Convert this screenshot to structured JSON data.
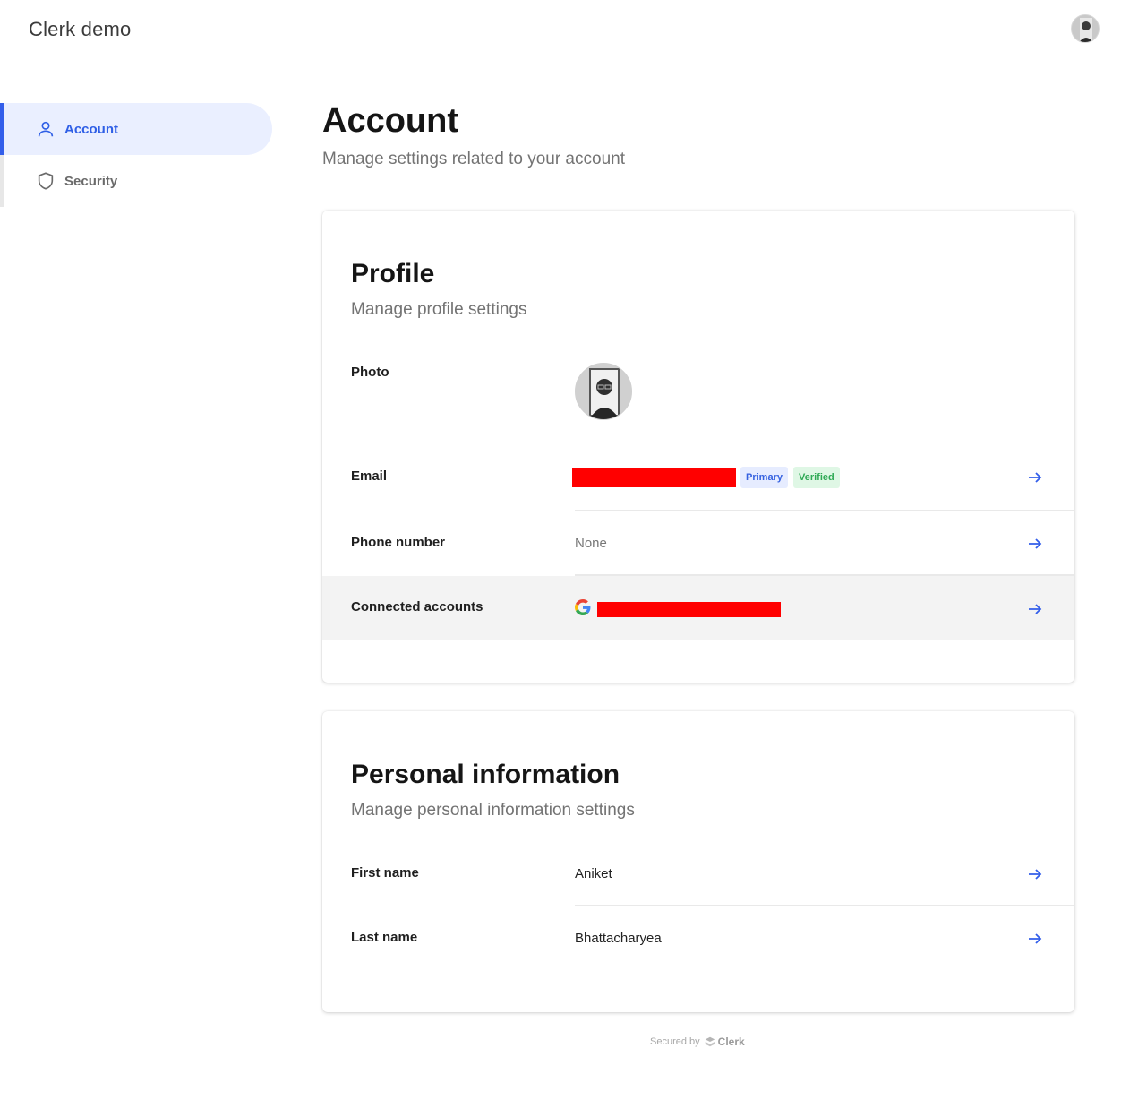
{
  "header": {
    "app_title": "Clerk demo",
    "avatar_icon": "user-avatar-icon"
  },
  "sidebar": {
    "items": [
      {
        "label": "Account",
        "icon": "user-icon",
        "active": true
      },
      {
        "label": "Security",
        "icon": "shield-icon",
        "active": false
      }
    ]
  },
  "main": {
    "title": "Account",
    "subtitle": "Manage settings related to your account"
  },
  "profile": {
    "title": "Profile",
    "subtitle": "Manage profile settings",
    "photo_label": "Photo",
    "email_label": "Email",
    "email_badges": {
      "primary": "Primary",
      "verified": "Verified"
    },
    "phone_label": "Phone number",
    "phone_value": "None",
    "connected_label": "Connected accounts",
    "connected_icon": "google-icon"
  },
  "personal": {
    "title": "Personal information",
    "subtitle": "Manage personal information settings",
    "first_name_label": "First name",
    "first_name_value": "Aniket",
    "last_name_label": "Last name",
    "last_name_value": "Bhattacharyea"
  },
  "footer": {
    "secured_by": "Secured by",
    "brand": "Clerk"
  },
  "colors": {
    "accent": "#335eea",
    "active_bg": "#eaefff",
    "redaction": "#ff0000"
  }
}
